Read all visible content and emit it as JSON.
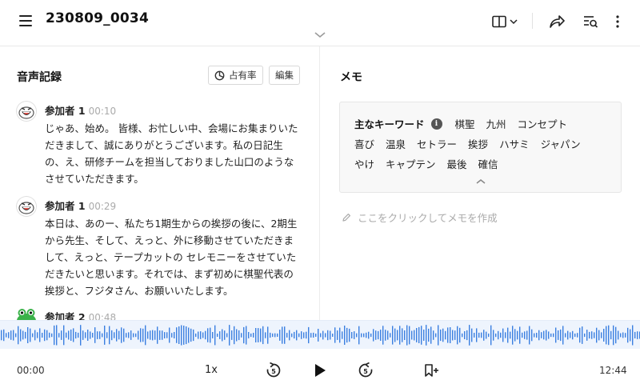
{
  "header": {
    "title": "230809_0034"
  },
  "transcript": {
    "section_title": "音声記録",
    "share_button_label": "占有率",
    "edit_button_label": "編集",
    "utterances": [
      {
        "speaker": "参加者 1",
        "time": "00:10",
        "text": "じゃあ、始め。 皆様、お忙しい中、会場にお集まりいただきまして、誠にありがとうございます。私の日記生の、え、研修チームを担当しておりました山口のようなさせていただきます。"
      },
      {
        "speaker": "参加者 1",
        "time": "00:29",
        "text": "本日は、あのー、私たち1期生からの挨拶の後に、2期生から先生、そして、えっと、外に移動させていただきまして、えっと、テープカットの セレモニーをさせていただきたいと思います。それでは、まず初めに棋聖代表の挨拶と、フジタさん、お願いいたします。"
      },
      {
        "speaker": "参加者 2",
        "time": "00:48",
        "text": ""
      }
    ]
  },
  "memo": {
    "section_title": "メモ",
    "keywords_label": "主なキーワード",
    "info_glyph": "i",
    "keywords_row1": [
      "棋聖",
      "九州",
      "コンセプト"
    ],
    "keywords_row2": [
      "喜び",
      "温泉",
      "セトラー",
      "挨拶",
      "ハサミ",
      "ジャパン"
    ],
    "keywords_row3": [
      "やけ",
      "キャプテン",
      "最後",
      "確信"
    ],
    "prompt": "ここをクリックしてメモを作成"
  },
  "player": {
    "current_time": "00:00",
    "total_time": "12:44",
    "speed": "1x",
    "skip_seconds": "5"
  },
  "colors": {
    "waveform": "#3a7fe0",
    "waveform_bg": "#eef4fd",
    "avatar1": "#3bb24a",
    "avatar2": "#2ea043"
  }
}
